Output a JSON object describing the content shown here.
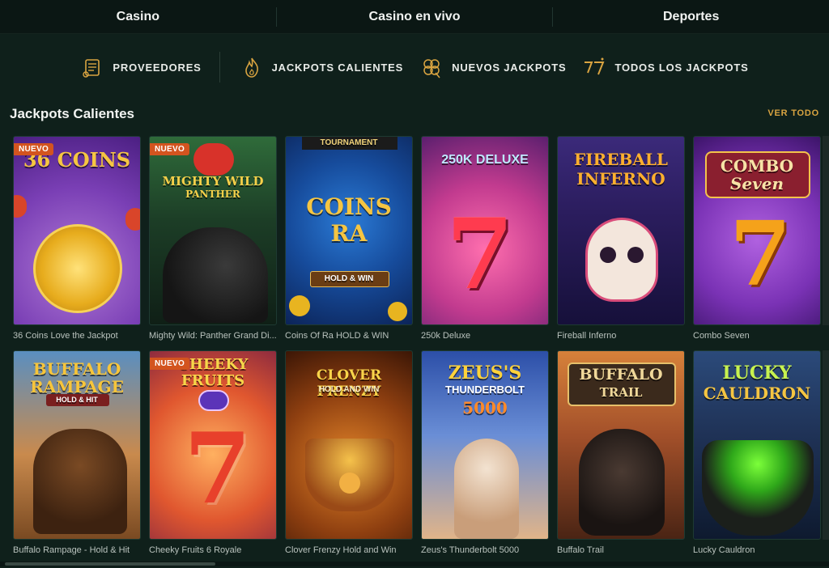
{
  "top_tabs": [
    "Casino",
    "Casino en vivo",
    "Deportes"
  ],
  "sub_nav": [
    {
      "label": "PROVEEDORES",
      "icon": "scroll-icon"
    },
    {
      "label": "JACKPOTS CALIENTES",
      "icon": "flame-icon"
    },
    {
      "label": "NUEVOS JACKPOTS",
      "icon": "clover-icon"
    },
    {
      "label": "TODOS LOS JACKPOTS",
      "icon": "lucky-seven-icon"
    }
  ],
  "section": {
    "title": "Jackpots Calientes",
    "see_all": "VER TODO"
  },
  "badge_label": "NUEVO",
  "games": [
    {
      "name": "36 Coins Love the Jackpot",
      "art": "36 COINS",
      "badge": true
    },
    {
      "name": "Mighty Wild: Panther Grand Di...",
      "art": "MIGHTY WILD",
      "art2": "PANTHER",
      "badge": true
    },
    {
      "name": "Coins Of Ra HOLD & WIN",
      "art": "COINS RA",
      "art_top": "TOURNAMENT",
      "art2": "HOLD & WIN",
      "badge": false
    },
    {
      "name": "250k Deluxe",
      "art": "250K DELUXE",
      "badge": false
    },
    {
      "name": "Fireball Inferno",
      "art": "FIREBALL",
      "art2": "INFERNO",
      "badge": false
    },
    {
      "name": "Combo Seven",
      "art": "COMBO",
      "art2": "Seven",
      "badge": false
    },
    {
      "name": "Buffalo Rampage - Hold & Hit",
      "art": "BUFFALO",
      "art2": "RAMPAGE",
      "art3": "HOLD & HIT",
      "badge": false
    },
    {
      "name": "Cheeky Fruits 6 Royale",
      "art": "CHEEKY",
      "art2": "FRUITS",
      "badge": true
    },
    {
      "name": "Clover Frenzy Hold and Win",
      "art": "CLOVER FRENZY",
      "art2": "HOLD AND WIN",
      "badge": false
    },
    {
      "name": "Zeus's Thunderbolt 5000",
      "art": "ZEUS'S",
      "art2": "THUNDERBOLT",
      "art3": "5000",
      "badge": false
    },
    {
      "name": "Buffalo Trail",
      "art": "BUFFALO",
      "art2": "TRAIL",
      "badge": false
    },
    {
      "name": "Lucky Cauldron",
      "art": "LUCKY",
      "art2": "CAULDRON",
      "badge": false
    }
  ],
  "colors": {
    "accent": "#d9a441",
    "badge": "#d3541f",
    "background": "#0f201b"
  }
}
